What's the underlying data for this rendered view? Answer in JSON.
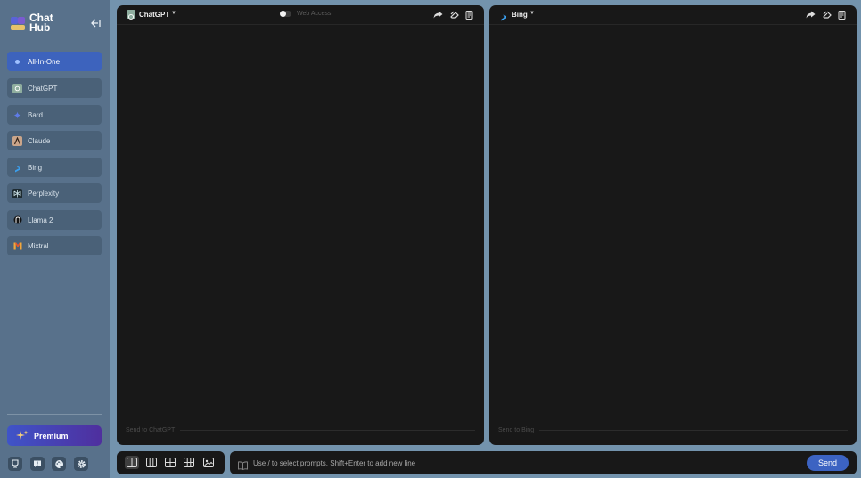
{
  "app": {
    "logo_line1": "Chat",
    "logo_line2": "Hub"
  },
  "sidebar": {
    "items": [
      {
        "label": "All-In-One",
        "icon": "all-in-one-icon",
        "active": true
      },
      {
        "label": "ChatGPT",
        "icon": "chatgpt-icon"
      },
      {
        "label": "Bard",
        "icon": "bard-icon"
      },
      {
        "label": "Claude",
        "icon": "claude-icon"
      },
      {
        "label": "Bing",
        "icon": "bing-icon"
      },
      {
        "label": "Perplexity",
        "icon": "perplexity-icon"
      },
      {
        "label": "Llama 2",
        "icon": "llama-icon"
      },
      {
        "label": "Mixtral",
        "icon": "mixtral-icon"
      }
    ],
    "premium_label": "Premium",
    "bottom_icons": [
      "feedback-icon",
      "chat-bubble-icon",
      "theme-palette-icon",
      "settings-gear-icon"
    ]
  },
  "panels": [
    {
      "bot": "ChatGPT",
      "web_access_label": "Web Access",
      "input_placeholder": "Send to ChatGPT"
    },
    {
      "bot": "Bing",
      "input_placeholder": "Send to Bing"
    }
  ],
  "layout_options": [
    "two-column-layout-icon",
    "three-column-layout-icon",
    "grid-2x2-layout-icon",
    "grid-3x2-layout-icon",
    "image-input-icon"
  ],
  "prompt": {
    "placeholder": "Use / to select prompts, Shift+Enter to add new line",
    "send_label": "Send"
  },
  "colors": {
    "sidebar_bg": "#58718b",
    "active_item": "#3d63bd",
    "panel_bg": "#181818",
    "send_button": "#3c63c2"
  }
}
